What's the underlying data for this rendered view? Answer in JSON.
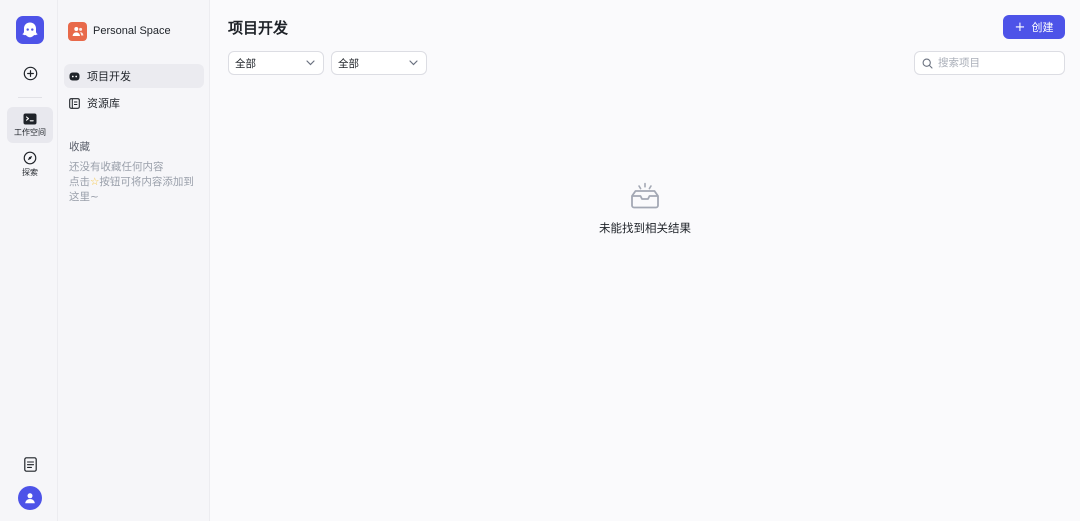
{
  "rail": {
    "create_icon": "plus-circle-icon",
    "items": [
      {
        "label": "工作空间",
        "icon": "workspace-folder-icon",
        "active": true
      },
      {
        "label": "探索",
        "icon": "compass-icon",
        "active": false
      }
    ],
    "bottom": {
      "docs_icon": "document-icon",
      "avatar_icon": "user-icon"
    }
  },
  "sidebar": {
    "space_name": "Personal Space",
    "nav": [
      {
        "label": "项目开发",
        "icon": "bot-icon",
        "active": true
      },
      {
        "label": "资源库",
        "icon": "library-icon",
        "active": false
      }
    ],
    "favorites": {
      "title": "收藏",
      "empty_line1": "还没有收藏任何内容",
      "empty_line2_prefix": "点击",
      "empty_line2_suffix": "按钮可将内容添加到这里~"
    }
  },
  "main": {
    "title": "项目开发",
    "create_label": "创建",
    "filters": [
      {
        "value": "全部"
      },
      {
        "value": "全部"
      }
    ],
    "search_placeholder": "搜索项目",
    "empty_text": "未能找到相关结果"
  },
  "colors": {
    "accent": "#4d53e8",
    "space_badge": "#e8694a",
    "star": "#f5c542"
  }
}
